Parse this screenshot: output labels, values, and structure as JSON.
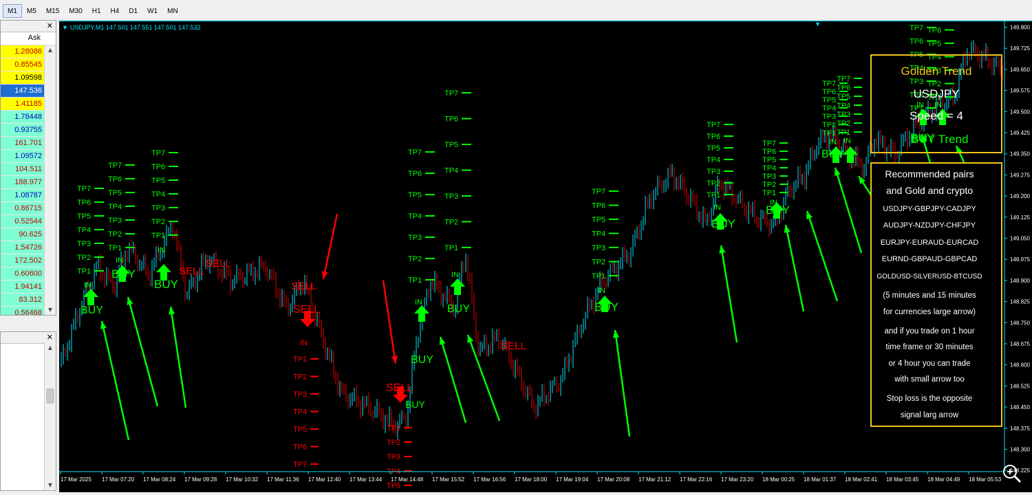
{
  "timeframes": [
    "M1",
    "M5",
    "M15",
    "M30",
    "H1",
    "H4",
    "D1",
    "W1",
    "MN"
  ],
  "active_timeframe": "M1",
  "market_watch": {
    "column": "Ask",
    "quotes": [
      {
        "v": "1.28086",
        "bg": "#ffff00",
        "fg": "#c00000"
      },
      {
        "v": "0.85545",
        "bg": "#ffff00",
        "fg": "#c00000"
      },
      {
        "v": "1.09598",
        "bg": "#ffff00",
        "fg": "#000000"
      },
      {
        "v": "147.536",
        "bg": "#1e6fd1",
        "fg": "#ffffff"
      },
      {
        "v": "1.41185",
        "bg": "#ffff00",
        "fg": "#c00000"
      },
      {
        "v": "1.78448",
        "bg": "#7fffd4",
        "fg": "#0000c0"
      },
      {
        "v": "0.93755",
        "bg": "#7fffd4",
        "fg": "#0000c0"
      },
      {
        "v": "161.701",
        "bg": "#7fffd4",
        "fg": "#c00000"
      },
      {
        "v": "1.09572",
        "bg": "#7fffd4",
        "fg": "#0000c0"
      },
      {
        "v": "104.511",
        "bg": "#7fffd4",
        "fg": "#c00000"
      },
      {
        "v": "188.977",
        "bg": "#7fffd4",
        "fg": "#c00000"
      },
      {
        "v": "1.08787",
        "bg": "#7fffd4",
        "fg": "#0000c0"
      },
      {
        "v": "0.86715",
        "bg": "#7fffd4",
        "fg": "#c00000"
      },
      {
        "v": "0.52544",
        "bg": "#7fffd4",
        "fg": "#c00000"
      },
      {
        "v": "90.625",
        "bg": "#7fffd4",
        "fg": "#c00000"
      },
      {
        "v": "1.54726",
        "bg": "#7fffd4",
        "fg": "#c00000"
      },
      {
        "v": "172.502",
        "bg": "#7fffd4",
        "fg": "#c00000"
      },
      {
        "v": "0.60600",
        "bg": "#7fffd4",
        "fg": "#c00000"
      },
      {
        "v": "1.94141",
        "bg": "#7fffd4",
        "fg": "#c00000"
      },
      {
        "v": "83.312",
        "bg": "#7fffd4",
        "fg": "#c00000"
      },
      {
        "v": "0.56468",
        "bg": "#7fffd4",
        "fg": "#c00000"
      }
    ]
  },
  "chart": {
    "header": "USDJPY,M1  147.501 147.551 147.501 147.532",
    "price_labels": [
      "149.800",
      "149.725",
      "149.650",
      "149.575",
      "149.500",
      "149.425",
      "149.350",
      "149.275",
      "149.200",
      "149.125",
      "149.050",
      "148.975",
      "148.900",
      "148.825",
      "148.750",
      "148.675",
      "148.600",
      "148.525",
      "148.450",
      "148.375",
      "148.300",
      "148.225"
    ],
    "time_labels": [
      "17 Mar 2025",
      "17 Mar 07:20",
      "17 Mar 08:24",
      "17 Mar 09:28",
      "17 Mar 10:32",
      "17 Mar 11:36",
      "17 Mar 12:40",
      "17 Mar 13:44",
      "17 Mar 14:48",
      "17 Mar 15:52",
      "17 Mar 16:56",
      "17 Mar 18:00",
      "17 Mar 19:04",
      "17 Mar 20:08",
      "17 Mar 21:12",
      "17 Mar 22:16",
      "17 Mar 23:20",
      "18 Mar 00:25",
      "18 Mar 01:37",
      "18 Mar 02:41",
      "18 Mar 03:45",
      "18 Mar 04:49",
      "18 Mar 05:53"
    ],
    "colors": {
      "bull": "#00e5ff",
      "bear": "#e00000",
      "buy": "#00ff00",
      "sell": "#ff0000",
      "axis": "#00e5ff"
    },
    "tp_labels": [
      "TP1",
      "TP2",
      "TP3",
      "TP4",
      "TP5",
      "TP6",
      "TP7"
    ],
    "in_label": "IN",
    "buy_label": "BUY",
    "sell_label": "SELL"
  },
  "info_box": {
    "title": "Golden Trend",
    "pair": "USDJPY",
    "speed": "Speed = 4",
    "trend": "BUY Trend"
  },
  "notes_box": {
    "lines": [
      "Recommended pairs",
      "and Gold and crypto",
      "USDJPY-GBPJPY-CADJPY",
      "AUDJPY-NZDJPY-CHFJPY",
      "EURJPY-EURAUD-EURCAD",
      "EURND-GBPAUD-GBPCAD",
      "GOLDUSD-SILVERUSD-BTCUSD",
      "(5 minutes and 15 minutes",
      "for currencies large arrow)",
      "and if you trade on 1 hour",
      "time frame or 30 minutes",
      "or 4 hour you can trade",
      "with small arrow too",
      "Stop loss is the opposite",
      "signal larg arrow"
    ]
  }
}
